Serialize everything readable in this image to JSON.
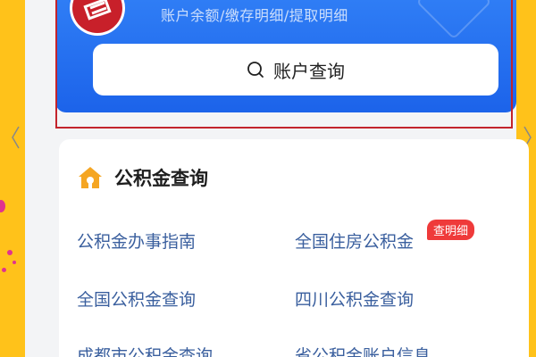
{
  "account_card": {
    "subtitle": "账户余额/缴存明细/提取明细",
    "query_button_label": "账户查询"
  },
  "section": {
    "title": "公积金查询",
    "items": [
      {
        "label": "公积金办事指南"
      },
      {
        "label": "全国住房公积金",
        "badge": "查明细"
      },
      {
        "label": "全国公积金查询"
      },
      {
        "label": "四川公积金查询"
      },
      {
        "label": "成都市公积金查询"
      },
      {
        "label": "省公积金账户信息"
      }
    ]
  },
  "colors": {
    "card_blue": "#1c63ea",
    "highlight_red": "#c3242c",
    "badge_red": "#ef3a3a",
    "link_blue": "#3a5f9e",
    "icon_orange": "#f5a623"
  },
  "icons": [
    "logo-badge",
    "search-icon",
    "house-icon",
    "carousel-arrow-left-icon",
    "carousel-arrow-right-icon"
  ]
}
